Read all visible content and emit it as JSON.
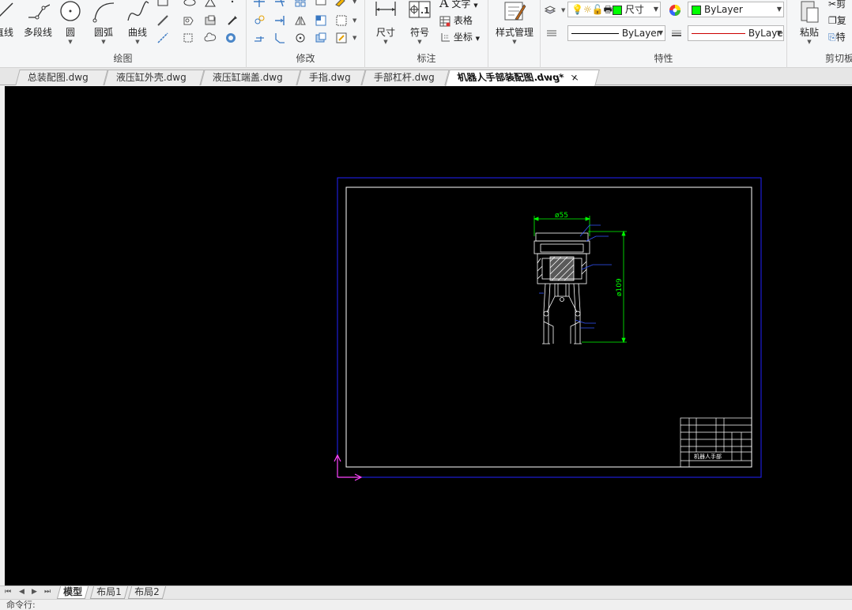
{
  "ribbon": {
    "draw_group": {
      "title": "绘图",
      "line_label": "直线",
      "polyline_label": "多段线",
      "circle_label": "圆",
      "arc_label": "圆弧",
      "curve_label": "曲线"
    },
    "modify_group": {
      "title": "修改"
    },
    "annotate_group": {
      "title": "标注",
      "dimension_label": "尺寸",
      "symbol_label": "符号",
      "text_label": "文字",
      "table_label": "表格",
      "coordinate_label": "坐标"
    },
    "style_group": {
      "style_label": "样式管理"
    },
    "properties_group": {
      "title": "特性",
      "layer_combo": "尺寸",
      "color_combo": "ByLayer",
      "linetype_combo": "ByLayer",
      "lineweight_combo": "ByLayer",
      "color_swatch": "#00ff00"
    },
    "clipboard_group": {
      "title": "剪切板",
      "paste_label": "粘贴",
      "cut_label": "剪",
      "copy_label": "复",
      "match_label": "特"
    }
  },
  "tabs": [
    {
      "label": "总装配图.dwg"
    },
    {
      "label": "液压缸外壳.dwg"
    },
    {
      "label": "液压缸端盖.dwg"
    },
    {
      "label": "手指.dwg"
    },
    {
      "label": "手部杠杆.dwg"
    },
    {
      "label": "机器人手部装配图.dwg*",
      "active": true,
      "close": "×"
    }
  ],
  "drawing": {
    "dim_top": "ø55",
    "dim_right": "ø109",
    "title_block_text": "机器人手部"
  },
  "layout_tabs": {
    "model": "模型",
    "layout1": "布局1",
    "layout2": "布局2"
  },
  "nav": {
    "first": "⏮",
    "prev": "◀",
    "next": "▶",
    "last": "⏭"
  },
  "command_line": "命令行:"
}
